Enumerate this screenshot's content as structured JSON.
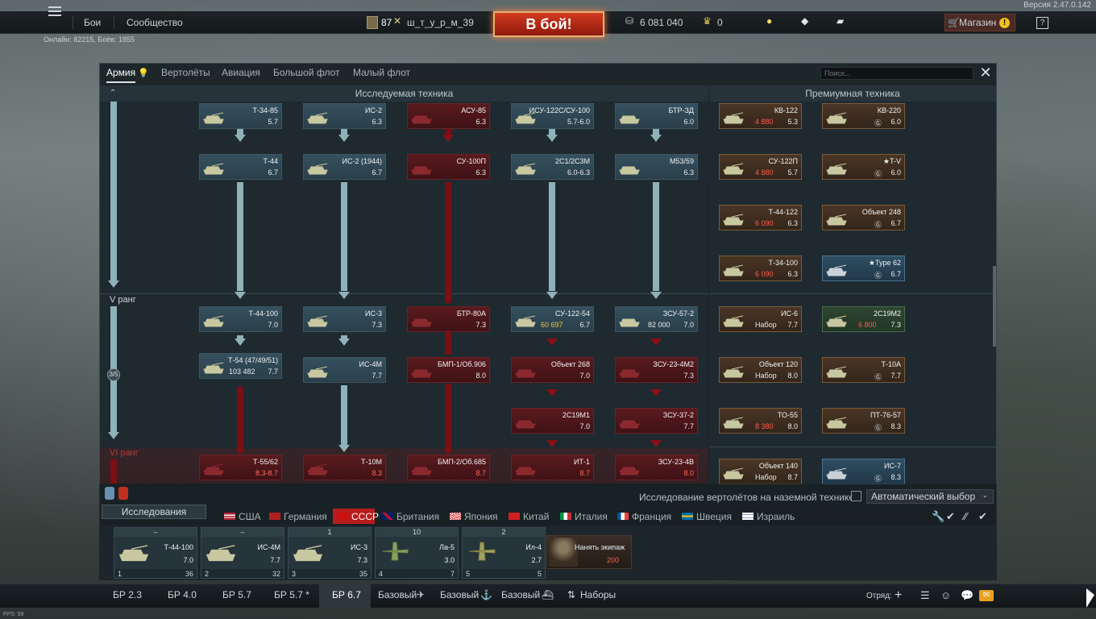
{
  "version": "Версия 2.47.0.142",
  "topbar": {
    "battles": "Бои",
    "community": "Сообщество",
    "level": "87",
    "nickname": "ш_т_у_р_м_39",
    "battle_button": "В бой!",
    "silver": "6 081 040",
    "gold": "0",
    "shop": "Магазин"
  },
  "online": "Онлайн: 82215, Боёв: 1855",
  "tabs": [
    "Армия",
    "Вертолёты",
    "Авиация",
    "Большой флот",
    "Малый флот"
  ],
  "search_placeholder": "Поиск...",
  "tree_header": "Исследуемая техника",
  "prem_header": "Премиумная техника",
  "rank5": "V ранг",
  "rank6": "VI ранг",
  "rank_progress": "3/5",
  "tree": {
    "c1": [
      {
        "name": "Т-34-85",
        "br": "5.7"
      },
      {
        "name": "Т-44",
        "br": "6.7"
      },
      {
        "name": "Т-44-100",
        "br": "7.0"
      },
      {
        "name": "Т-54 (47/49/51)",
        "br": "7.7",
        "price": "103 482"
      },
      {
        "name": "Т-55/62",
        "br": "8.3-8.7"
      }
    ],
    "c2": [
      {
        "name": "ИС-2",
        "br": "6.3"
      },
      {
        "name": "ИС-2 (1944)",
        "br": "6.7"
      },
      {
        "name": "ИС-3",
        "br": "7.3"
      },
      {
        "name": "ИС-4М",
        "br": "7.7"
      },
      {
        "name": "Т-10М",
        "br": "8.3"
      }
    ],
    "c3": [
      {
        "name": "АСУ-85",
        "br": "6.3"
      },
      {
        "name": "СУ-100П",
        "br": "6.3"
      },
      {
        "name": "БТР-80А",
        "br": "7.3"
      },
      {
        "name": "БМП-1/Об.906",
        "br": "8.0"
      },
      {
        "name": "БМП-2/Об.685",
        "br": "8.7"
      }
    ],
    "c4": [
      {
        "name": "ИСУ-122С/СУ-100",
        "br": "5.7-6.0"
      },
      {
        "name": "2С1/2С3М",
        "br": "6.0-6.3"
      },
      {
        "name": "СУ-122-54",
        "br": "6.7",
        "price": "60 697"
      },
      {
        "name": "Объект 268",
        "br": "7.0"
      },
      {
        "name": "2С19М1",
        "br": "7.0"
      },
      {
        "name": "ИТ-1",
        "br": "8.7"
      }
    ],
    "c5": [
      {
        "name": "БТР-ЗД",
        "br": "6.0"
      },
      {
        "name": "M53/59",
        "br": "6.3"
      },
      {
        "name": "ЗСУ-57-2",
        "br": "7.0",
        "price": "82 000"
      },
      {
        "name": "ЗСУ-23-4М2",
        "br": "7.3"
      },
      {
        "name": "ЗСУ-37-2",
        "br": "7.7"
      },
      {
        "name": "ЗСУ-23-4В",
        "br": "8.0"
      }
    ]
  },
  "premium": [
    {
      "name": "КВ-122",
      "br": "5.3",
      "price": "4 880"
    },
    {
      "name": "КВ-220",
      "br": "6.0",
      "price": "Ⓖ"
    },
    {
      "name": "СУ-122П",
      "br": "5.7",
      "price": "4 880"
    },
    {
      "name": "★T-V",
      "br": "6.0",
      "price": "Ⓖ"
    },
    {
      "name": "Т-44-122",
      "br": "6.3",
      "price": "6 090"
    },
    {
      "name": "Объект 248",
      "br": "6.7",
      "price": "Ⓖ"
    },
    {
      "name": "Т-34-100",
      "br": "6.3",
      "price": "6 090"
    },
    {
      "name": "★Type 62",
      "br": "6.7",
      "price": "Ⓖ"
    },
    {
      "name": "ИС-6",
      "br": "7.7",
      "price": "Набор"
    },
    {
      "name": "2С19М2",
      "br": "7.3",
      "price": "6 800"
    },
    {
      "name": "Объект 120",
      "br": "8.0",
      "price": "Набор"
    },
    {
      "name": "Т-10А",
      "br": "7.7",
      "price": "Ⓖ"
    },
    {
      "name": "ТО-55",
      "br": "8.0",
      "price": "8 380"
    },
    {
      "name": "ПТ-76-57",
      "br": "8.3",
      "price": "Ⓖ"
    },
    {
      "name": "Объект 140",
      "br": "8.7",
      "price": "Набор"
    },
    {
      "name": "ИС-7",
      "br": "8.3",
      "price": "Ⓖ"
    }
  ],
  "research_button": "Исследования",
  "countries": [
    "США",
    "Германия",
    "СССР",
    "Британия",
    "Япония",
    "Китай",
    "Италия",
    "Франция",
    "Швеция",
    "Израиль"
  ],
  "heli_research": "Исследование вертолётов на наземной технике",
  "auto_select": "Автоматический выбор",
  "crew": [
    {
      "head": "–",
      "name": "Т-44-100",
      "br": "7.0",
      "num": "1",
      "count": "36"
    },
    {
      "head": "–",
      "name": "ИС-4М",
      "br": "7.7",
      "num": "2",
      "count": "32"
    },
    {
      "head": "1",
      "name": "ИС-3",
      "br": "7.3",
      "num": "3",
      "count": "35"
    },
    {
      "head": "10",
      "name": "Ла-5",
      "br": "3.0",
      "num": "4",
      "count": "7"
    },
    {
      "head": "2",
      "name": "Ил-4",
      "br": "2.7",
      "num": "5",
      "count": "5"
    }
  ],
  "hire_crew": {
    "label": "Нанять экипаж",
    "price": "200"
  },
  "bottom_tabs": [
    "БР 2.3",
    "БР 4.0",
    "БР 5.7",
    "БР 5.7 *",
    "БР 6.7",
    "Базовый",
    "Базовый",
    "Базовый",
    "Наборы"
  ],
  "squad": "Отряд:",
  "fps": "FPS: 59"
}
